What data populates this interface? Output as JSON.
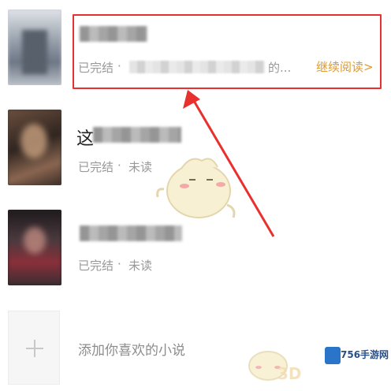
{
  "books": [
    {
      "status": "已完结",
      "separator": "·",
      "progress_suffix": "的...",
      "action": "继续阅读>"
    },
    {
      "title_fragment": "这",
      "status": "已完结",
      "separator": "·",
      "progress": "未读"
    },
    {
      "status": "已完结",
      "separator": "·",
      "progress": "未读"
    }
  ],
  "add": {
    "plus": "+",
    "label": "添加你喜欢的小说"
  },
  "watermark": {
    "site": "756手游网",
    "prefix": "3D"
  },
  "colors": {
    "accent": "#e09a2a",
    "annotation": "#e8312f",
    "muted": "#999999"
  }
}
